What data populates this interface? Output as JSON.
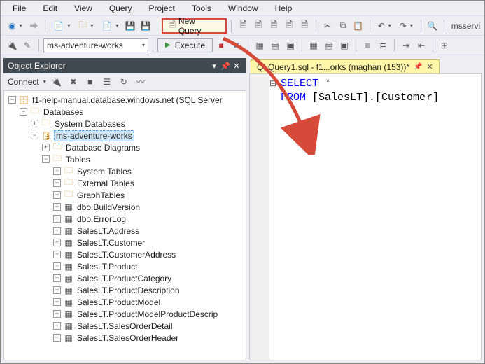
{
  "menu": {
    "items": [
      "File",
      "Edit",
      "View",
      "Query",
      "Project",
      "Tools",
      "Window",
      "Help"
    ]
  },
  "toolbar1": {
    "new_query_label": "New Query",
    "ms_service_text": "msservi"
  },
  "toolbar2": {
    "db_name": "ms-adventure-works",
    "execute_label": "Execute"
  },
  "oe": {
    "title": "Object Explorer",
    "connect_label": "Connect",
    "root": "f1-help-manual.database.windows.net (SQL Server ",
    "nodes": {
      "databases": "Databases",
      "sysdb": "System Databases",
      "advworks": "ms-adventure-works",
      "dbdiag": "Database Diagrams",
      "tables": "Tables",
      "systables": "System Tables",
      "exttables": "External Tables",
      "graphtables": "GraphTables",
      "t0": "dbo.BuildVersion",
      "t1": "dbo.ErrorLog",
      "t2": "SalesLT.Address",
      "t3": "SalesLT.Customer",
      "t4": "SalesLT.CustomerAddress",
      "t5": "SalesLT.Product",
      "t6": "SalesLT.ProductCategory",
      "t7": "SalesLT.ProductDescription",
      "t8": "SalesLT.ProductModel",
      "t9": "SalesLT.ProductModelProductDescrip",
      "t10": "SalesLT.SalesOrderDetail",
      "t11": "SalesLT.SalesOrderHeader"
    }
  },
  "editor": {
    "tab_title": "QLQuery1.sql - f1...orks (maghan (153))*",
    "code": {
      "l1_kw": "SELECT",
      "l1_rest": " *",
      "l2_kw": "FROM",
      "l2_rest_a": " [SalesLT].[Custome",
      "l2_rest_b": "r]"
    }
  }
}
